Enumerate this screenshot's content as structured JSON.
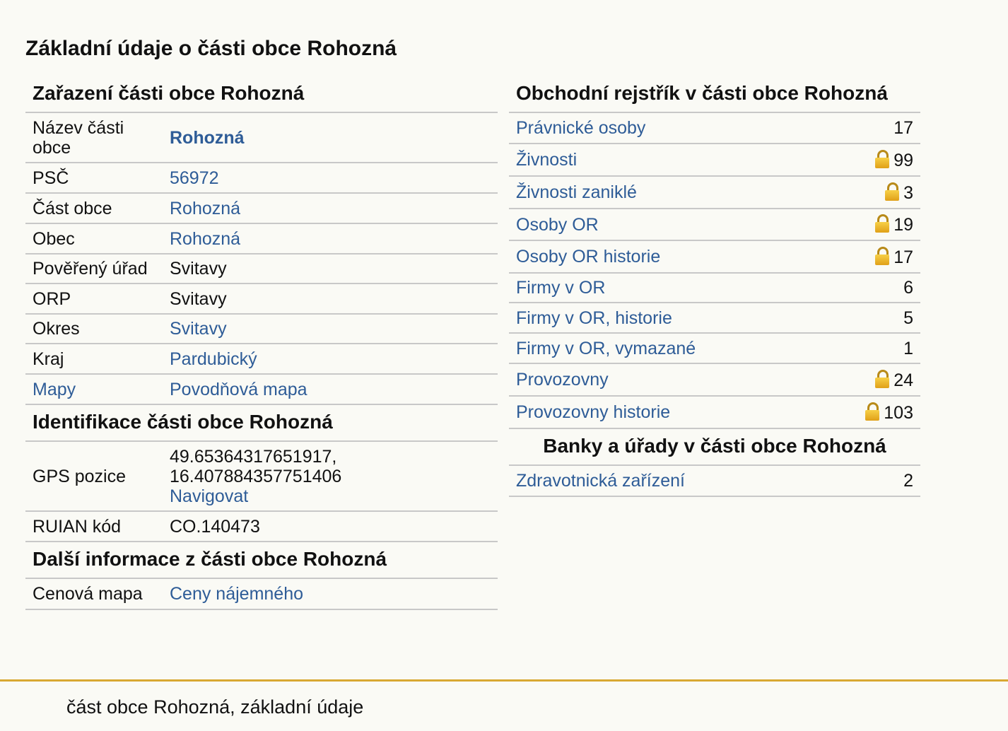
{
  "page_title": "Základní údaje o části obce Rohozná",
  "zarazeni": {
    "title": "Zařazení části obce Rohozná",
    "rows": [
      {
        "label": "Název části obce",
        "value": "Rohozná"
      },
      {
        "label": "PSČ",
        "value": "56972"
      },
      {
        "label": "Část obce",
        "value": "Rohozná"
      },
      {
        "label": "Obec",
        "value": "Rohozná"
      },
      {
        "label": "Pověřený úřad",
        "value": "Svitavy"
      },
      {
        "label": "ORP",
        "value": "Svitavy"
      },
      {
        "label": "Okres",
        "value": "Svitavy"
      },
      {
        "label": "Kraj",
        "value": "Pardubický"
      },
      {
        "label": "Mapy",
        "value": "Povodňová mapa"
      }
    ]
  },
  "identifikace": {
    "title": "Identifikace části obce Rohozná",
    "gps_label": "GPS pozice",
    "gps_lat": "49.65364317651917,",
    "gps_lon": "16.407884357751406",
    "navigate": "Navigovat",
    "ruian_label": "RUIAN kód",
    "ruian_value": "CO.140473"
  },
  "dalsi": {
    "title": "Další informace z části obce Rohozná",
    "label": "Cenová mapa",
    "value": "Ceny nájemného"
  },
  "obchodni": {
    "title": "Obchodní rejstřík v části obce Rohozná",
    "rows": [
      {
        "label": "Právnické osoby",
        "count": "17",
        "locked": false
      },
      {
        "label": "Živnosti",
        "count": "99",
        "locked": true
      },
      {
        "label": "Živnosti zaniklé",
        "count": "3",
        "locked": true
      },
      {
        "label": "Osoby OR",
        "count": "19",
        "locked": true
      },
      {
        "label": "Osoby OR historie",
        "count": "17",
        "locked": true
      },
      {
        "label": "Firmy v OR",
        "count": "6",
        "locked": false
      },
      {
        "label": "Firmy v OR, historie",
        "count": "5",
        "locked": false
      },
      {
        "label": "Firmy v OR, vymazané",
        "count": "1",
        "locked": false
      },
      {
        "label": "Provozovny",
        "count": "24",
        "locked": true
      },
      {
        "label": "Provozovny historie",
        "count": "103",
        "locked": true
      }
    ]
  },
  "banky": {
    "title": "Banky a úřady v části obce Rohozná",
    "rows": [
      {
        "label": "Zdravotnická zařízení",
        "count": "2"
      }
    ]
  },
  "footer": {
    "text": "část obce Rohozná, základní údaje"
  },
  "colors": {
    "link": "#2e5c97",
    "background": "#fafaf5",
    "footer_line": "#d8a832",
    "lock": "#f0b82a"
  },
  "icons": {
    "lock": "lock-icon"
  }
}
